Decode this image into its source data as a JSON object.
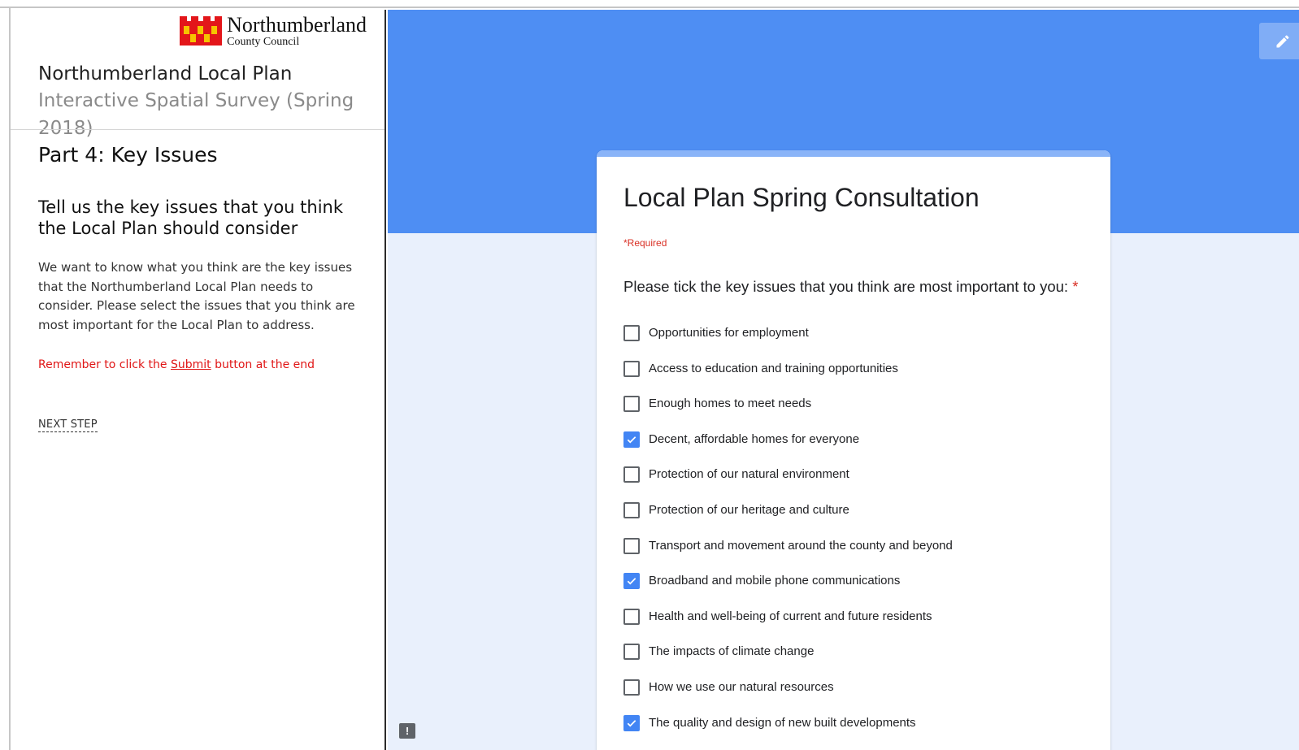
{
  "sidebar": {
    "logo": {
      "name": "Northumberland",
      "sub": "County Council",
      "colors": [
        "#e3161a",
        "#f6c400"
      ]
    },
    "app_title": "Northumberland Local Plan",
    "app_subtitle": "Interactive Spatial Survey (Spring 2018)",
    "part_title": "Part 4: Key Issues",
    "section_heading": "Tell us the key issues that you think the Local Plan should consider",
    "intro_text": "We want to know what you think are the key issues that the Northumberland Local Plan needs to consider. Please select the issues that you think are most important for the Local Plan to address.",
    "reminder": {
      "prefix": "Remember to click the ",
      "link": "Submit",
      "suffix": " button at the end",
      "color": "#e01616"
    },
    "next_step": "NEXT STEP"
  },
  "main": {
    "banner_color": "#4e8ef3",
    "background_color": "#e9f0fc",
    "edit_icon": "pencil-icon",
    "feedback_icon": "feedback-icon",
    "feedback_glyph": "!"
  },
  "form": {
    "title": "Local Plan Spring Consultation",
    "required_note": "*Required",
    "question": "Please tick the key issues that you think are most important to you:",
    "question_required_mark": "*",
    "accent_color": "#4285f4",
    "options": [
      {
        "label": "Opportunities for employment",
        "checked": false
      },
      {
        "label": "Access to education and training opportunities",
        "checked": false
      },
      {
        "label": "Enough homes to meet needs",
        "checked": false
      },
      {
        "label": "Decent, affordable homes for everyone",
        "checked": true
      },
      {
        "label": "Protection of our natural environment",
        "checked": false
      },
      {
        "label": "Protection of our heritage and culture",
        "checked": false
      },
      {
        "label": "Transport and movement around the county and beyond",
        "checked": false
      },
      {
        "label": "Broadband and mobile phone communications",
        "checked": true
      },
      {
        "label": "Health and well-being of current and future residents",
        "checked": false
      },
      {
        "label": "The impacts of climate change",
        "checked": false
      },
      {
        "label": "How we use our natural resources",
        "checked": false
      },
      {
        "label": "The quality and design of new built developments",
        "checked": true
      }
    ]
  }
}
